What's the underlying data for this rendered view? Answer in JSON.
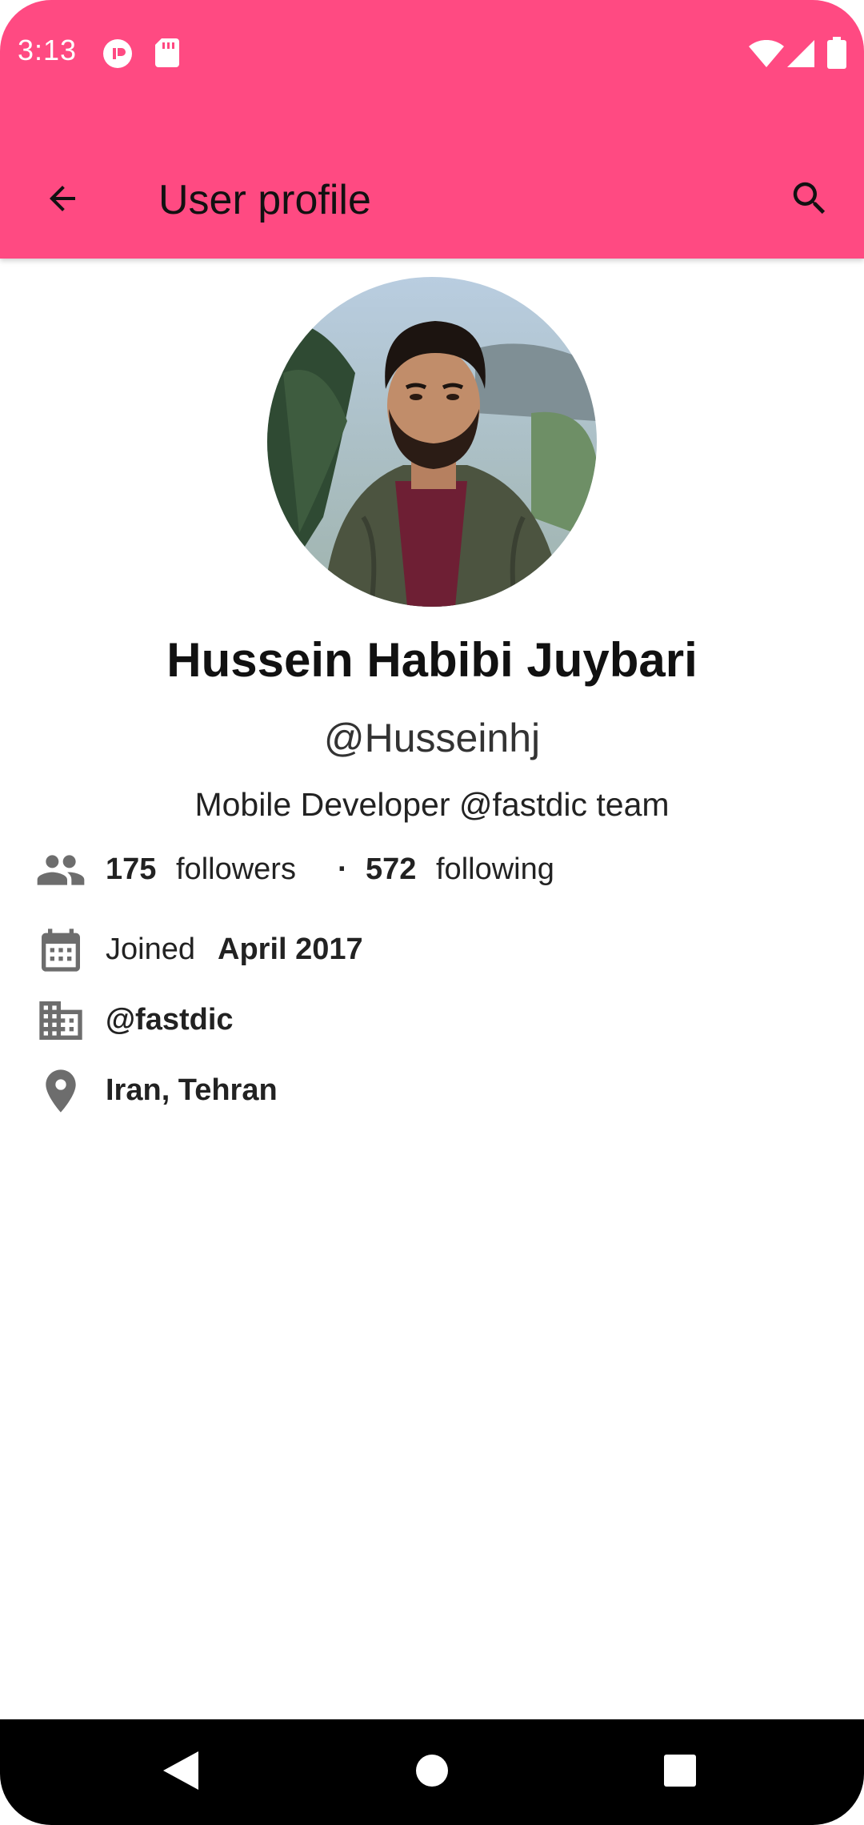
{
  "status_bar": {
    "time": "3:13",
    "icons": [
      "app-notification-icon",
      "sd-card-icon",
      "wifi-icon",
      "cell-signal-icon",
      "battery-icon"
    ]
  },
  "app_bar": {
    "title": "User profile",
    "back_icon": "arrow-back-icon",
    "search_icon": "search-icon",
    "background": "#FF4A82"
  },
  "profile": {
    "name": "Hussein Habibi Juybari",
    "username": "@Husseinhj",
    "bio": "Mobile Developer @fastdic team",
    "followers_count": "175",
    "followers_label": "followers",
    "separator": "·",
    "following_count": "572",
    "following_label": "following",
    "joined_label": "Joined",
    "joined_date": "April 2017",
    "company": "@fastdic",
    "location": "Iran, Tehran"
  },
  "nav_bar": {
    "icons": [
      "nav-back-icon",
      "nav-home-icon",
      "nav-recents-icon"
    ]
  }
}
